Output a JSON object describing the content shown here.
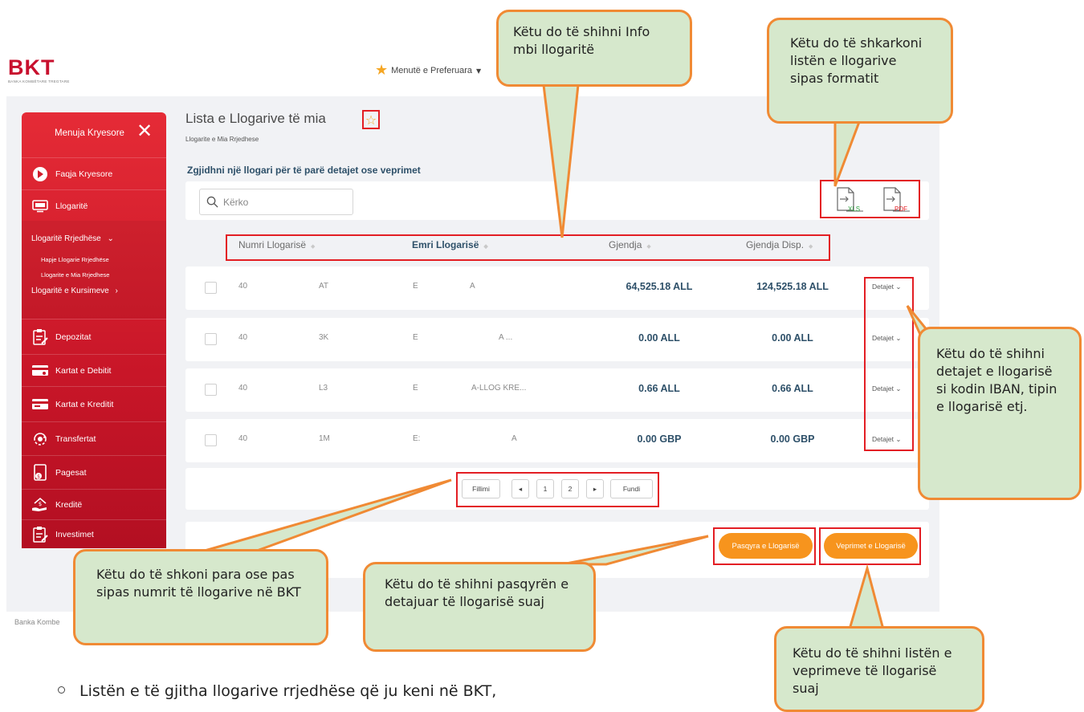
{
  "header": {
    "logo_text": "BKT",
    "logo_subtext": "BANKA KOMBËTARE TREGTARE",
    "favorites_label": "Menutë e Preferuara"
  },
  "sidebar": {
    "title": "Menuja Kryesore",
    "close_symbol": "✕",
    "items": {
      "home": "Faqja Kryesore",
      "accounts": "Llogaritë",
      "current_accounts": "Llogaritë Rrjedhëse",
      "open_current_account": "Hapje Llogarie Rrjedhëse",
      "my_current_accounts": "Llogarite e Mia Rrjedhese",
      "savings_accounts": "Llogaritë e Kursimeve",
      "deposits": "Depozitat",
      "debit_cards": "Kartat e Debitit",
      "credit_cards": "Kartat e Kreditit",
      "transfers": "Transfertat",
      "payments": "Pagesat",
      "loans": "Kreditë",
      "investments": "Investimet"
    },
    "submenu_open_caret": "⌄",
    "submenu_closed_caret": "›"
  },
  "main": {
    "title": "Lista e Llogarive të mia",
    "breadcrumb": "Llogarite e Mia Rrjedhese",
    "instructions": "Zgjidhni një llogari për të parë detajet ose veprimet",
    "search_placeholder": "Kërko",
    "export": {
      "xls_label": "XLS",
      "pdf_label": "PDF"
    },
    "table": {
      "columns": [
        "Numri Llogarisë",
        "Emri Llogarisë",
        "Gjendja",
        "Gjendja Disp."
      ],
      "rows": [
        {
          "num_a": "40",
          "num_b": "AT",
          "name_a": "E",
          "name_b": "A",
          "balance": "64,525.18 ALL",
          "available": "124,525.18 ALL",
          "details": "Detajet"
        },
        {
          "num_a": "40",
          "num_b": "3K",
          "name_a": "E",
          "name_b": "A ...",
          "balance": "0.00 ALL",
          "available": "0.00 ALL",
          "details": "Detajet"
        },
        {
          "num_a": "40",
          "num_b": "L3",
          "name_a": "E",
          "name_b": "A-LLOG KRE...",
          "balance": "0.66 ALL",
          "available": "0.66 ALL",
          "details": "Detajet"
        },
        {
          "num_a": "40",
          "num_b": "1M",
          "name_a": "E:",
          "name_b": "A",
          "balance": "0.00 GBP",
          "available": "0.00 GBP",
          "details": "Detajet"
        }
      ]
    },
    "pagination": {
      "first": "Fillimi",
      "prev": "◂",
      "pages": [
        "1",
        "2"
      ],
      "next": "▸",
      "last": "Fundi"
    },
    "actions": {
      "statement": "Pasqyra e Llogarisë",
      "transactions": "Veprimet e Llogarisë"
    },
    "footer_text": "Banka Kombe"
  },
  "callouts": {
    "info": "Këtu do të shihni Info mbi llogaritë",
    "download": "Këtu do të shkarkoni listën e llogarive sipas formatit",
    "details": "Këtu do të shihni detajet e llogarisë si kodin IBAN, tipin e llogarisë etj.",
    "pagination": "Këtu do të shkoni para ose pas sipas numrit të llogarive në BKT",
    "statement": "Këtu do të shihni pasqyrën e detajuar të llogarisë suaj",
    "transactions": "Këtu do të shihni listën e veprimeve të llogarisë suaj"
  },
  "bullet_text": "Listën e të gjitha llogarive rrjedhëse që ju keni në BKT,",
  "colors": {
    "brand_red": "#c8102e",
    "highlight_red": "#e31e24",
    "action_orange": "#f7941d",
    "amount_blue": "#2e5069",
    "callout_fill": "#d6e8cc",
    "callout_border": "#f08a34"
  },
  "icons": {
    "favorites": "star-icon",
    "title_favorite": "star-outline-icon",
    "search": "search-icon",
    "close": "close-icon"
  }
}
